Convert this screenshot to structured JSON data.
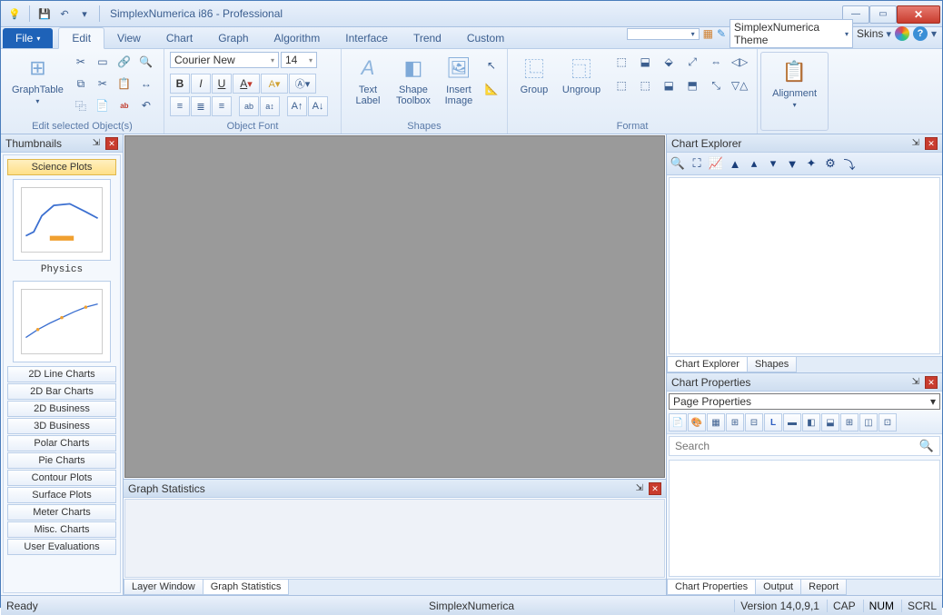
{
  "title": "SimplexNumerica i86 - Professional",
  "qat": {
    "save": "💾",
    "undo": "↶",
    "dd": "▾"
  },
  "tabs": [
    "File",
    "Edit",
    "View",
    "Chart",
    "Graph",
    "Algorithm",
    "Interface",
    "Trend",
    "Custom"
  ],
  "active_tab": "Edit",
  "theme_combo": "SimplexNumerica Theme",
  "skins_label": "Skins",
  "ribbon": {
    "graphtable": "GraphTable",
    "edit_sel": "Edit selected Object(s)",
    "font_name": "Courier New",
    "font_size": "14",
    "object_font": "Object Font",
    "text_label": "Text\nLabel",
    "shape_toolbox": "Shape\nToolbox",
    "insert_image": "Insert\nImage",
    "shapes": "Shapes",
    "group": "Group",
    "ungroup": "Ungroup",
    "format": "Format",
    "alignment": "Alignment"
  },
  "thumbnails": {
    "title": "Thumbnails",
    "selected": "Science Plots",
    "caption1": "Physics",
    "cats": [
      "2D Line Charts",
      "2D Bar Charts",
      "2D Business",
      "3D Business",
      "Polar Charts",
      "Pie Charts",
      "Contour Plots",
      "Surface Plots",
      "Meter Charts",
      "Misc. Charts",
      "User Evaluations"
    ]
  },
  "graph_stats": {
    "title": "Graph Statistics",
    "tabs": [
      "Layer Window",
      "Graph Statistics"
    ]
  },
  "chart_explorer": {
    "title": "Chart Explorer",
    "tabs": [
      "Chart Explorer",
      "Shapes"
    ]
  },
  "chart_props": {
    "title": "Chart Properties",
    "combo": "Page Properties",
    "search_placeholder": "Search",
    "tabs": [
      "Chart Properties",
      "Output",
      "Report"
    ]
  },
  "status": {
    "ready": "Ready",
    "app": "SimplexNumerica",
    "version": "Version 14,0,9,1",
    "cap": "CAP",
    "num": "NUM",
    "scrl": "SCRL"
  }
}
